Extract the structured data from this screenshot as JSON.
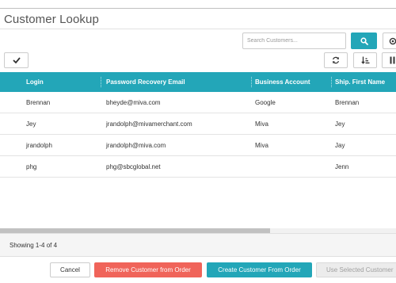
{
  "dialog": {
    "title": "Customer Lookup"
  },
  "search": {
    "placeholder": "Search Customers..."
  },
  "grid": {
    "columns": [
      "Login",
      "Password Recovery Email",
      "Business Account",
      "Ship. First Name"
    ],
    "rows": [
      {
        "login": "Brennan",
        "email": "bheyde@miva.com",
        "business_account": "Google",
        "ship_first_name": "Brennan"
      },
      {
        "login": "Jey",
        "email": "jrandolph@mivamerchant.com",
        "business_account": "Miva",
        "ship_first_name": "Jey"
      },
      {
        "login": "jrandolph",
        "email": "jrandolph@miva.com",
        "business_account": "Miva",
        "ship_first_name": "Jay"
      },
      {
        "login": "phg",
        "email": "phg@sbcglobal.net",
        "business_account": "",
        "ship_first_name": "Jenn"
      }
    ],
    "status": "Showing 1-4 of 4"
  },
  "footer": {
    "cancel": "Cancel",
    "remove": "Remove Customer from Order",
    "create": "Create Customer From Order",
    "use_selected": "Use Selected Customer"
  },
  "colors": {
    "accent": "#23a6b8",
    "danger": "#f0645a"
  },
  "icons": {
    "search": "search-icon",
    "options": "gear-icon",
    "select_all": "check-icon",
    "refresh": "refresh-icon",
    "sort": "sort-icon",
    "columns": "columns-icon"
  }
}
